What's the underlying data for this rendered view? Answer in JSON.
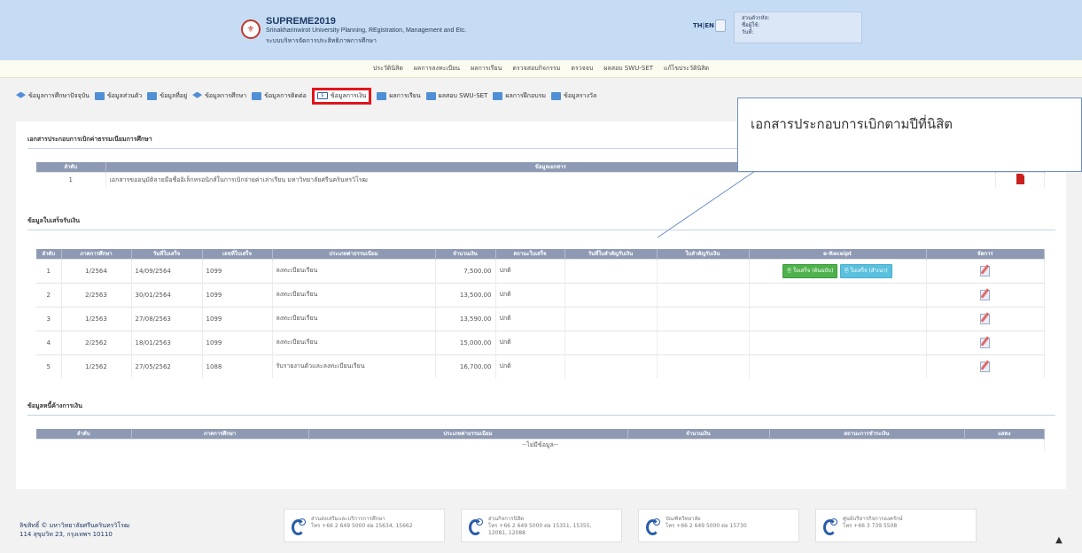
{
  "header": {
    "app_name": "SUPREME2019",
    "subtitle": "Srinakharinwirot University Planning, REgistration, Management and Etc.",
    "subtitle_th": "ระบบบริหารจัดการประสิทธิภาพการศึกษา",
    "lang": "TH|EN",
    "user": {
      "line1": "ส่วนตัวรหัส:",
      "line2": "ชื่อผู้ใช้:",
      "line3": "วันที่:"
    }
  },
  "top_menu": [
    "ประวัตินิสิต",
    "ผลการลงทะเบียน",
    "ผลการเรียน",
    "ตรวจสอบกิจกรรม",
    "ตรวจจบ",
    "ผลสอบ SWU-SET",
    "แก้ไขประวัตินิสิต"
  ],
  "tabs": [
    {
      "label": "ข้อมูลการศึกษาปัจจุบัน",
      "icon": "graduation-cap-icon"
    },
    {
      "label": "ข้อมูลส่วนตัว",
      "icon": "document-icon"
    },
    {
      "label": "ข้อมูลที่อยู่",
      "icon": "document-icon"
    },
    {
      "label": "ข้อมูลการศึกษา",
      "icon": "graduation-cap-icon"
    },
    {
      "label": "ข้อมูลการติดต่อ",
      "icon": "document-icon"
    },
    {
      "label": "ข้อมูลการเงิน",
      "icon": "money-icon"
    },
    {
      "label": "ผลการเรียน",
      "icon": "document-icon"
    },
    {
      "label": "ผลสอบ SWU-SET",
      "icon": "document-icon"
    },
    {
      "label": "ผลการฝึกอบรม",
      "icon": "document-icon"
    },
    {
      "label": "ข้อมูลรางวัล",
      "icon": "document-icon"
    }
  ],
  "callout": "เอกสารประกอบการเบิกตามปีที่นิสิต",
  "section_docs": {
    "title": "เอกสารประกอบการเบิกค่าธรรมเนียมการศึกษา",
    "headers": [
      "ลำดับ",
      "ข้อมูลเอกสาร",
      ""
    ],
    "rows": [
      {
        "no": "1",
        "doc": "เอกสารขออนุมัติลายมือชื่ออิเล็กทรอนิกส์ในการเบิกจ่ายค่าเล่าเรียน มหาวิทยาลัยศรีนครินทรวิโรฒ"
      }
    ]
  },
  "section_receipts": {
    "title": "ข้อมูลใบเสร็จรับเงิน",
    "headers": [
      "ลำดับ",
      "ภาคการศึกษา",
      "วันที่ใบเสร็จ",
      "เลขที่ใบเสร็จ",
      "ประเภทค่าธรรมเนียม",
      "จำนวนเงิน",
      "สถานะใบเสร็จ",
      "วันที่ใบสำคัญรับเงิน",
      "ใบสำคัญรับเงิน",
      "e-Receipt",
      "จัดการ"
    ],
    "receipt_btn_th": "ใบเสร็จ (ต้นฉบับ)",
    "receipt_btn_copy": "ใบเสร็จ (สำเนา)",
    "rows": [
      {
        "no": "1",
        "term": "1/2564",
        "date": "14/09/2564",
        "num": "1099",
        "type": "ลงทะเบียนเรียน",
        "amount": "7,500.00",
        "status": "ปกติ"
      },
      {
        "no": "2",
        "term": "2/2563",
        "date": "30/01/2564",
        "num": "1099",
        "type": "ลงทะเบียนเรียน",
        "amount": "13,500.00",
        "status": "ปกติ"
      },
      {
        "no": "3",
        "term": "1/2563",
        "date": "27/08/2563",
        "num": "1099",
        "type": "ลงทะเบียนเรียน",
        "amount": "13,590.00",
        "status": "ปกติ"
      },
      {
        "no": "4",
        "term": "2/2562",
        "date": "18/01/2563",
        "num": "1099",
        "type": "ลงทะเบียนเรียน",
        "amount": "15,000.00",
        "status": "ปกติ"
      },
      {
        "no": "5",
        "term": "1/2562",
        "date": "27/05/2562",
        "num": "1088",
        "type": "รับรายงานตัวและลงทะเบียนเรียน",
        "amount": "16,700.00",
        "status": "ปกติ"
      }
    ]
  },
  "section_debt": {
    "title": "ข้อมูลหนี้ค้างการเงิน",
    "headers": [
      "ลำดับ",
      "ภาคการศึกษา",
      "ประเภทค่าธรรมเนียม",
      "จำนวนเงิน",
      "สถานะการชำระเงิน",
      "แสดง"
    ],
    "empty": "--ไม่มีข้อมูล--"
  },
  "footer": {
    "copyright": "ลิขสิทธิ์ © มหาวิทยาลัยศรีนครินทรวิโรฒ",
    "address": "114 สุขุมวิท 23, กรุงเทพฯ 10110",
    "contacts": [
      {
        "name": "ส่วนส่งเสริมและบริการการศึกษา",
        "tel": "โทร +66 2 649 5000 ต่อ 15634, 15662"
      },
      {
        "name": "ส่วนกิจการนิสิต",
        "tel": "โทร +66 2 649 5000 ต่อ 15351, 15355,",
        "tel2": "12081, 12088"
      },
      {
        "name": "บัณฑิตวิทยาลัย",
        "tel": "โทร +66 2 649 5000 ต่อ 15730"
      },
      {
        "name": "ศูนย์บริหารกิจการองครักษ์",
        "tel": "โทร +66 3 739 5508"
      }
    ]
  },
  "colors": {
    "header_bg": "#c6dcf4",
    "table_header": "#8e9ab4",
    "active_tab_border": "#e0161c",
    "btn_green": "#4fb24d",
    "btn_cyan": "#5bc0de"
  }
}
